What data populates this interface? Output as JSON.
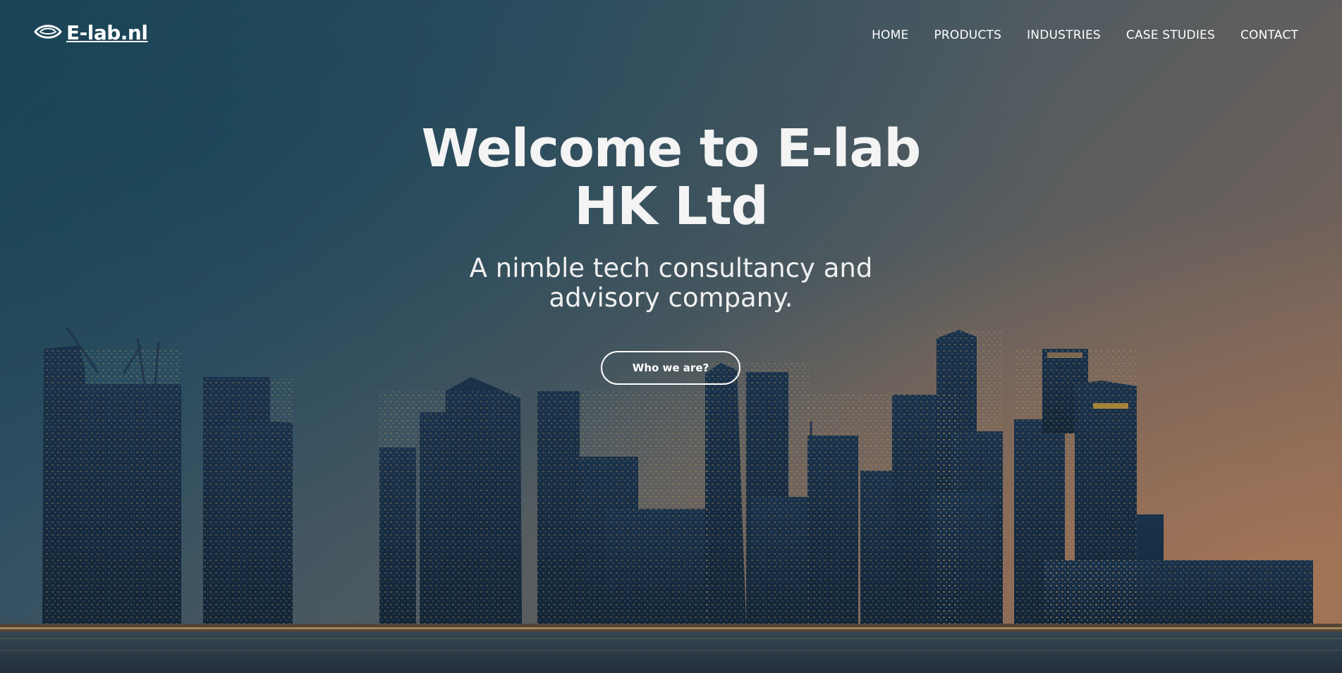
{
  "brand": {
    "logo_text": "E-lab.nl"
  },
  "nav": {
    "items": [
      {
        "label": "HOME"
      },
      {
        "label": "PRODUCTS"
      },
      {
        "label": "INDUSTRIES"
      },
      {
        "label": "CASE STUDIES"
      },
      {
        "label": "CONTACT"
      }
    ]
  },
  "hero": {
    "title_line1": "Welcome to E-lab",
    "title_line2": "HK Ltd",
    "subtitle_line1": "A nimble tech consultancy and",
    "subtitle_line2": "advisory company.",
    "cta_label": "Who we are?",
    "background": "city-skyline-at-dusk",
    "colors": {
      "sky_top": "#1f4a5e",
      "sky_horizon": "#9a7560",
      "text": "#ffffff"
    }
  }
}
